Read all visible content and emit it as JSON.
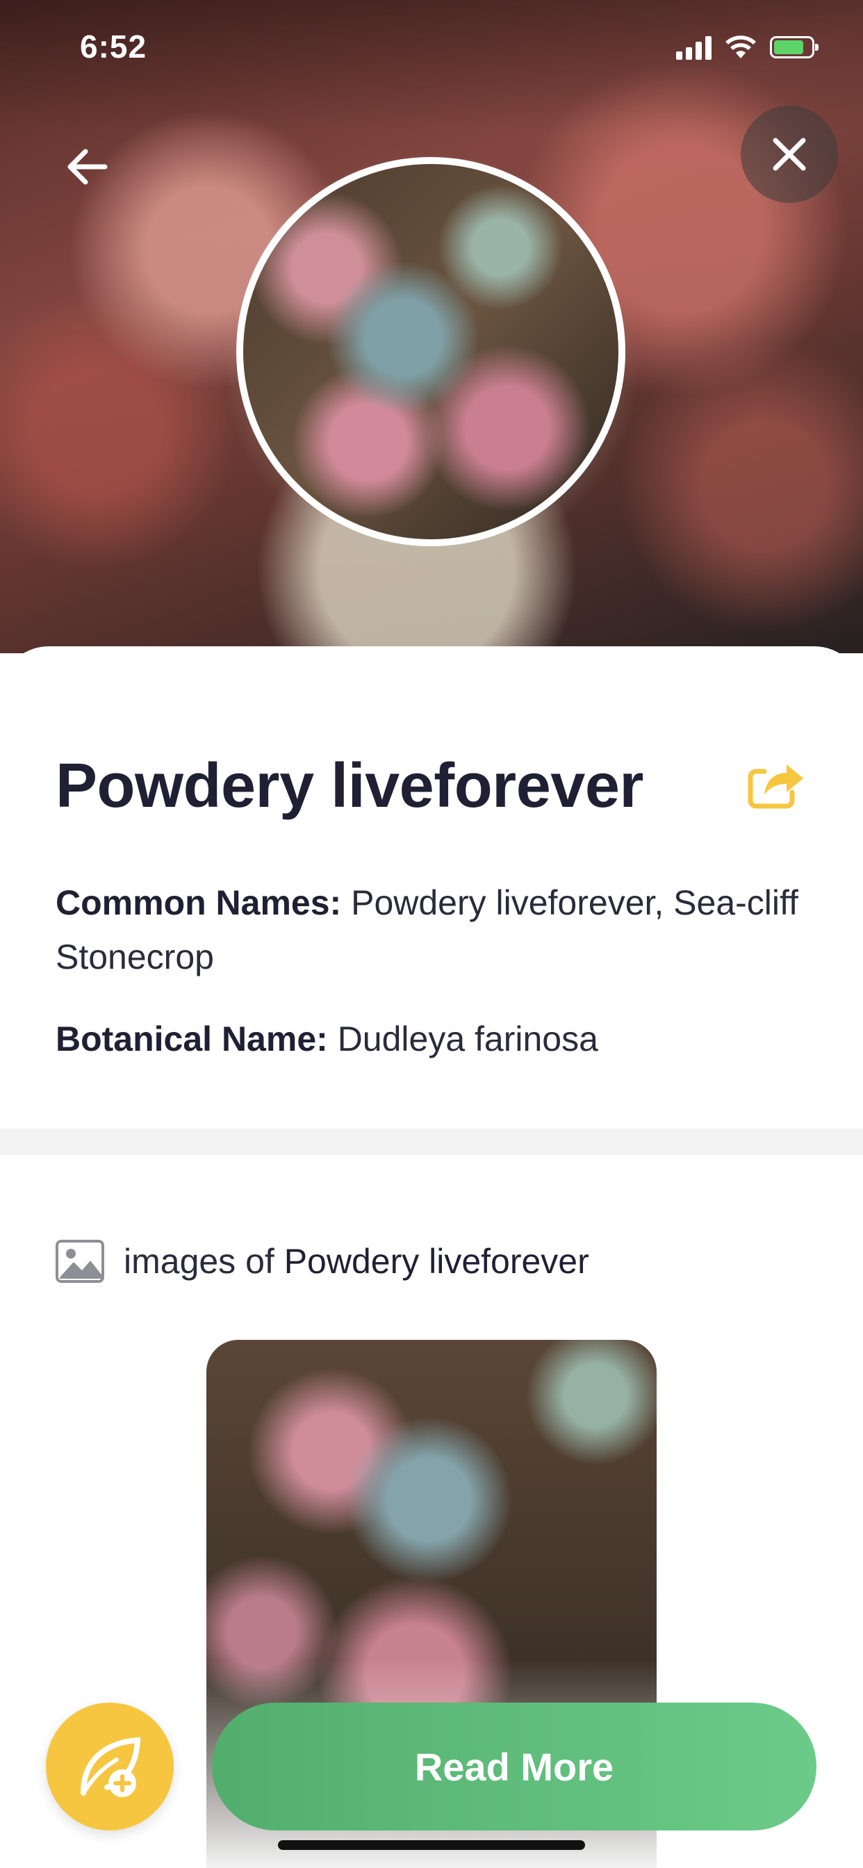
{
  "status_bar": {
    "time": "6:52"
  },
  "plant": {
    "title": "Powdery liveforever",
    "common_names_label": "Common Names:",
    "common_names_value": "Powdery liveforever, Sea-cliff Stonecrop",
    "botanical_name_label": "Botanical Name:",
    "botanical_name_value": "Dudleya farinosa"
  },
  "images_section": {
    "prefix": "images of",
    "plant_name": "Powdery liveforever"
  },
  "actions": {
    "read_more": "Read More"
  },
  "colors": {
    "accent_green": "#5bbb78",
    "accent_yellow": "#f6c640",
    "title_color": "#1f2033"
  },
  "icons": [
    "arrow-left-icon",
    "close-icon",
    "share-icon",
    "image-icon",
    "leaf-plus-icon",
    "signal-icon",
    "wifi-icon",
    "battery-icon"
  ]
}
